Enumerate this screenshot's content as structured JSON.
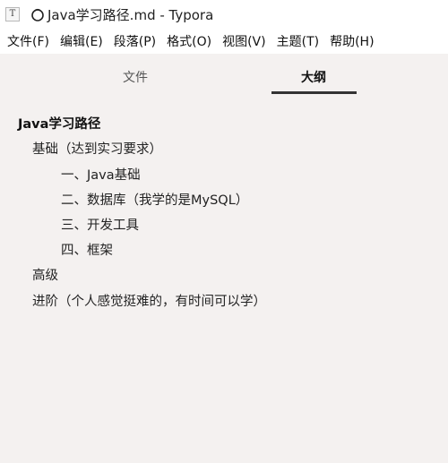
{
  "titlebar": {
    "app_icon_letter": "T",
    "title": "Java学习路径.md - Typora"
  },
  "menu": {
    "items": [
      "文件(F)",
      "编辑(E)",
      "段落(P)",
      "格式(O)",
      "视图(V)",
      "主题(T)",
      "帮助(H)"
    ]
  },
  "sidebar": {
    "tabs": [
      "文件",
      "大纲"
    ],
    "active_tab": "大纲"
  },
  "outline": {
    "items": [
      {
        "level": 1,
        "text": "Java学习路径"
      },
      {
        "level": 2,
        "text": "基础（达到实习要求）"
      },
      {
        "level": 3,
        "text": "一、Java基础"
      },
      {
        "level": 3,
        "text": "二、数据库（我学的是MySQL）"
      },
      {
        "level": 3,
        "text": "三、开发工具"
      },
      {
        "level": 3,
        "text": "四、框架"
      },
      {
        "level": 2,
        "text": "高级"
      },
      {
        "level": 2,
        "text": "进阶（个人感觉挺难的，有时间可以学）"
      }
    ]
  },
  "icons": {
    "app": "typora-app-icon",
    "unsaved": "unsaved-document-icon"
  }
}
